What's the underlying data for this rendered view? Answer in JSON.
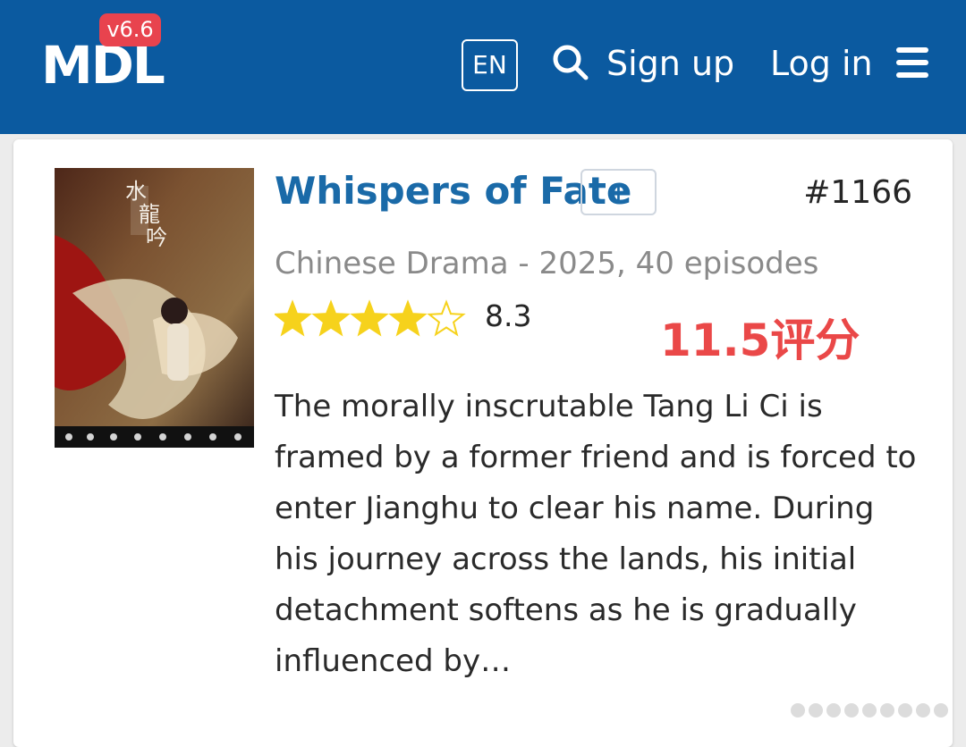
{
  "header": {
    "logo": "MDL",
    "version": "v6.6",
    "language": "EN",
    "sign_up": "Sign up",
    "log_in": "Log in"
  },
  "show": {
    "title": "Whispers of Fate",
    "add_label": "+",
    "rank": "#1166",
    "meta": "Chinese Drama - 2025, 40 episodes",
    "rating": "8.3",
    "stars_filled": 4,
    "stars_total": 5,
    "synopsis": "The morally inscrutable Tang Li Ci is framed by a former friend and is forced to enter Jianghu to clear his name. During his journey across the lands, his initial detachment softens as he is gradually influenced by…"
  },
  "overlay": {
    "text": "11.5评分"
  },
  "colors": {
    "header_bg": "#0b5aa0",
    "title": "#1a6aa8",
    "version_badge": "#e8434e",
    "star": "#f6d21c",
    "overlay": "#ea4848"
  }
}
